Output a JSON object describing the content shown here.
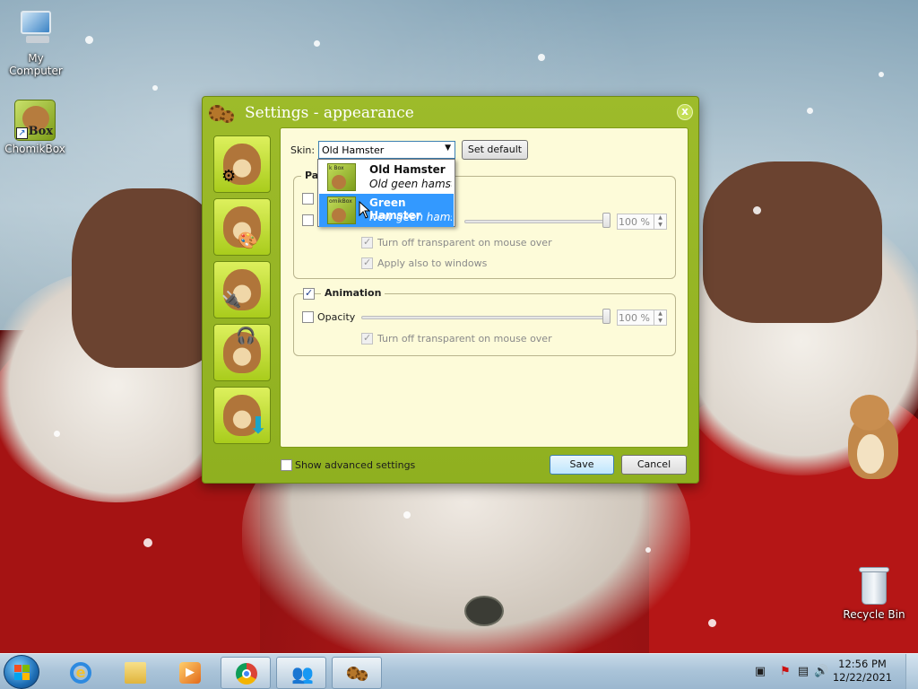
{
  "desktop": {
    "icons": [
      {
        "label": "My Computer"
      },
      {
        "label": "ChomikBox"
      },
      {
        "label": "Recycle Bin"
      }
    ],
    "chomikbox_icon_text": "Box"
  },
  "window": {
    "title": "Settings - appearance",
    "close_glyph": "x",
    "skin_label": "Skin:",
    "skin_selected": "Old Hamster",
    "set_default_label": "Set default",
    "panel_group": {
      "title_partial": "Pa",
      "slider_value": "100 %",
      "options": [
        {
          "label": "Turn off transparent on mouse over",
          "checked": true,
          "enabled": false
        },
        {
          "label": "Apply also to windows",
          "checked": true,
          "enabled": false
        }
      ]
    },
    "animation_group": {
      "title": "Animation",
      "checked": true,
      "opacity_label": "Opacity",
      "opacity_checked": false,
      "slider_value": "100 %",
      "option_label": "Turn off transparent on mouse over"
    },
    "show_advanced_label": "Show advanced settings",
    "save_label": "Save",
    "cancel_label": "Cancel"
  },
  "skin_dropdown": {
    "items": [
      {
        "name": "Old Hamster",
        "description": "Old geen hamster",
        "selected": false
      },
      {
        "name": "Green Hamster",
        "description": "New geen hamster",
        "selected": true
      }
    ]
  },
  "taskbar": {
    "pinned": [
      "internet-explorer",
      "windows-explorer",
      "media-player",
      "chrome",
      "user-accounts",
      "chomikbox"
    ],
    "clock_time": "12:56 PM",
    "clock_date": "12/22/2021"
  },
  "colors": {
    "window_frame": "#9dbb2a",
    "panel_bg": "#fdfbd9",
    "selection": "#3399ff"
  }
}
